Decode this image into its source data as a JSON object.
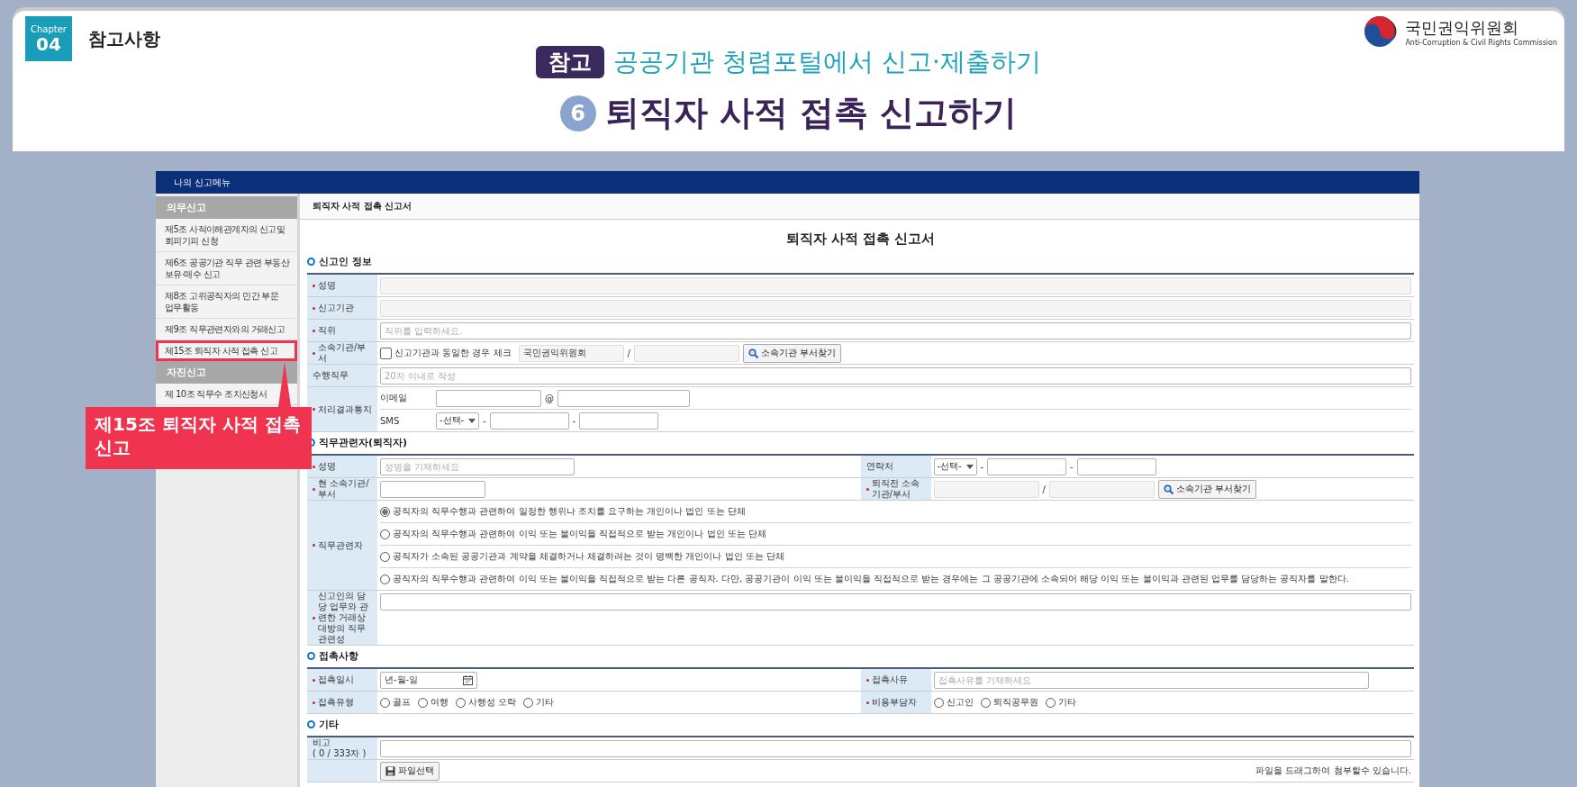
{
  "slide": {
    "chapter_label": "Chapter",
    "chapter_number": "04",
    "section": "참고사항",
    "tag": "참고",
    "subtitle": "공공기관 청렴포털에서 신고·제출하기",
    "step": "6",
    "title": "퇴직자 사적 접촉 신고하기",
    "org_name": "국민권익위원회",
    "org_english": "Anti-Corruption & Civil Rights Commission"
  },
  "portal": {
    "nav_title": "나의 신고메뉴",
    "sidebar": [
      {
        "heading": "의무신고",
        "items": [
          {
            "label": "제5조 사적이해관계자의 신고및 회피기피 신청",
            "selected": false
          },
          {
            "label": "제6조 공공기관 직무 관련 부동산 보유·매수 신고",
            "selected": false
          },
          {
            "label": "제8조 고위공직자의 민간 부문 업무활동",
            "selected": false
          },
          {
            "label": "제9조 직무관련자와의 거래신고",
            "selected": false
          },
          {
            "label": "제15조 퇴직자 사적 접촉 신고",
            "selected": true
          }
        ]
      },
      {
        "heading": "자진신고",
        "items": [
          {
            "label": "제 10조 직무수 조치신청서",
            "selected": false
          }
        ]
      }
    ],
    "callout": "제15조 퇴직자 사적 접촉 신고",
    "breadcrumb": "퇴직자 사적 접촉 신고서",
    "form": {
      "title": "퇴직자 사적 접촉 신고서",
      "sections": [
        {
          "heading": "신고인 정보",
          "rows": [
            {
              "cells": [
                {
                  "label": "성명",
                  "required": true,
                  "lines": [
                    [
                      {
                        "kind": "input_full",
                        "readonly": true
                      }
                    ]
                  ]
                }
              ]
            },
            {
              "cells": [
                {
                  "label": "신고기관",
                  "required": true,
                  "lines": [
                    [
                      {
                        "kind": "input_full",
                        "readonly": true
                      }
                    ]
                  ]
                }
              ]
            },
            {
              "cells": [
                {
                  "label": "직위",
                  "required": true,
                  "lines": [
                    [
                      {
                        "kind": "input_full",
                        "readonly": false,
                        "placeholder": "직위를 입력하세요."
                      }
                    ]
                  ]
                }
              ]
            },
            {
              "cells": [
                {
                  "label": "소속기관/부서",
                  "required": true,
                  "lines": [
                    [
                      {
                        "kind": "checkbox",
                        "label": "신고기관과 동일한 경우 체크",
                        "checked": false
                      },
                      {
                        "kind": "input_m",
                        "readonly": true,
                        "value": "국민권익위원회"
                      },
                      {
                        "kind": "sep",
                        "text": "/"
                      },
                      {
                        "kind": "input_m",
                        "readonly": true
                      },
                      {
                        "kind": "search_button",
                        "label": "소속기관 부서찾기"
                      }
                    ]
                  ]
                }
              ]
            },
            {
              "cells": [
                {
                  "label": "수행직무",
                  "required": false,
                  "lines": [
                    [
                      {
                        "kind": "input_full",
                        "readonly": false,
                        "placeholder": "20자 이내로 작성"
                      }
                    ]
                  ]
                }
              ]
            },
            {
              "cells": [
                {
                  "label": "처리결과통지",
                  "required": true,
                  "lines": [
                    [
                      {
                        "kind": "sublabel",
                        "text": "이메일"
                      },
                      {
                        "kind": "input_m",
                        "readonly": false
                      },
                      {
                        "kind": "sep",
                        "text": "@"
                      },
                      {
                        "kind": "input_l",
                        "readonly": false
                      }
                    ],
                    [
                      {
                        "kind": "sublabel",
                        "text": "SMS"
                      },
                      {
                        "kind": "select",
                        "value": "-선택-"
                      },
                      {
                        "kind": "sep",
                        "text": "-"
                      },
                      {
                        "kind": "input_s",
                        "readonly": false
                      },
                      {
                        "kind": "sep",
                        "text": "-"
                      },
                      {
                        "kind": "input_s",
                        "readonly": false
                      }
                    ]
                  ]
                }
              ]
            }
          ]
        },
        {
          "heading": "직무관련자(퇴직자)",
          "rows": [
            {
              "cells": [
                {
                  "label": "성명",
                  "required": true,
                  "lines": [
                    [
                      {
                        "kind": "input_xl",
                        "readonly": false,
                        "placeholder": "성명을 기재하세요"
                      }
                    ]
                  ]
                },
                {
                  "label": "연락처",
                  "required": false,
                  "lines": [
                    [
                      {
                        "kind": "select",
                        "value": "-선택-"
                      },
                      {
                        "kind": "sep",
                        "text": "-"
                      },
                      {
                        "kind": "input_s",
                        "readonly": false
                      },
                      {
                        "kind": "sep",
                        "text": "-"
                      },
                      {
                        "kind": "input_s",
                        "readonly": false
                      }
                    ]
                  ]
                }
              ]
            },
            {
              "cells": [
                {
                  "label": "현 소속기관/부서",
                  "required": true,
                  "lines": [
                    [
                      {
                        "kind": "input_m",
                        "readonly": false
                      }
                    ]
                  ]
                },
                {
                  "label": "퇴직전 소속기관/부서",
                  "required": true,
                  "lines": [
                    [
                      {
                        "kind": "input_m",
                        "readonly": true
                      },
                      {
                        "kind": "sep",
                        "text": "/"
                      },
                      {
                        "kind": "input_m",
                        "readonly": true
                      },
                      {
                        "kind": "search_button",
                        "label": "소속기관 부서찾기"
                      }
                    ]
                  ]
                }
              ]
            },
            {
              "cells": [
                {
                  "label": "직무관련자",
                  "required": true,
                  "lines": [
                    [
                      {
                        "kind": "radio",
                        "label": "공직자의 직무수행과 관련하여 일정한 행위나 조치를 요구하는 개인이나 법인 또는 단체",
                        "selected": true
                      }
                    ],
                    [
                      {
                        "kind": "radio",
                        "label": "공직자의 직무수행과 관련하여 이익 또는 불이익을 직접적으로 받는 개인이나 법인 또는 단체",
                        "selected": false
                      }
                    ],
                    [
                      {
                        "kind": "radio",
                        "label": "공직자가 소속된 공공기관과 계약을 체결하거나 체결하려는 것이 명백한 개인이나 법인 또는 단체",
                        "selected": false
                      }
                    ],
                    [
                      {
                        "kind": "radio",
                        "label": "공직자의 직무수행과 관련하여 이익 또는 불이익을 직접적으로 받는 다른 공직자. 다만, 공공기관이 이익 또는 불이익을 직접적으로 받는 경우에는 그 공공기관에 소속되어 해당 이익 또는 불이익과 관련된 업무를 담당하는 공직자를 말한다.",
                        "selected": false
                      }
                    ]
                  ]
                }
              ]
            },
            {
              "cells": [
                {
                  "label": "신고인의 담당 업무와 관련한 거래상대방의 직무관련성",
                  "required": true,
                  "lines": [
                    [
                      {
                        "kind": "input_full",
                        "readonly": false
                      }
                    ]
                  ]
                }
              ]
            }
          ]
        },
        {
          "heading": "접촉사항",
          "rows": [
            {
              "cells": [
                {
                  "label": "접촉일시",
                  "required": true,
                  "lines": [
                    [
                      {
                        "kind": "date",
                        "placeholder": "년-월-일"
                      }
                    ]
                  ]
                },
                {
                  "label": "접촉사유",
                  "required": true,
                  "lines": [
                    [
                      {
                        "kind": "input_xxl",
                        "readonly": false,
                        "placeholder": "접촉사유를 기재하세요"
                      }
                    ]
                  ]
                }
              ]
            },
            {
              "cells": [
                {
                  "label": "접촉유형",
                  "required": true,
                  "lines": [
                    [
                      {
                        "kind": "radio",
                        "label": "골프",
                        "selected": false
                      },
                      {
                        "kind": "radio",
                        "label": "여행",
                        "selected": false
                      },
                      {
                        "kind": "radio",
                        "label": "사행성 오락",
                        "selected": false
                      },
                      {
                        "kind": "radio",
                        "label": "기타",
                        "selected": false
                      }
                    ]
                  ]
                },
                {
                  "label": "비용부담자",
                  "required": true,
                  "lines": [
                    [
                      {
                        "kind": "radio",
                        "label": "신고인",
                        "selected": false
                      },
                      {
                        "kind": "radio",
                        "label": "퇴직공무원",
                        "selected": false
                      },
                      {
                        "kind": "radio",
                        "label": "기타",
                        "selected": false
                      }
                    ]
                  ]
                }
              ]
            }
          ]
        },
        {
          "heading": "기타",
          "rows": [
            {
              "cells": [
                {
                  "label": "비고",
                  "note": "( 0 / 333자 )",
                  "required": false,
                  "lines": [
                    [
                      {
                        "kind": "input_full",
                        "readonly": false
                      }
                    ]
                  ]
                }
              ]
            },
            {
              "cells": [
                {
                  "required": false,
                  "lines": [
                    [
                      {
                        "kind": "file_button",
                        "label": "파일선택"
                      },
                      {
                        "kind": "hint",
                        "text": "파일을 드래그하여 첨부할수 있습니다."
                      }
                    ]
                  ]
                }
              ]
            }
          ]
        }
      ]
    }
  }
}
